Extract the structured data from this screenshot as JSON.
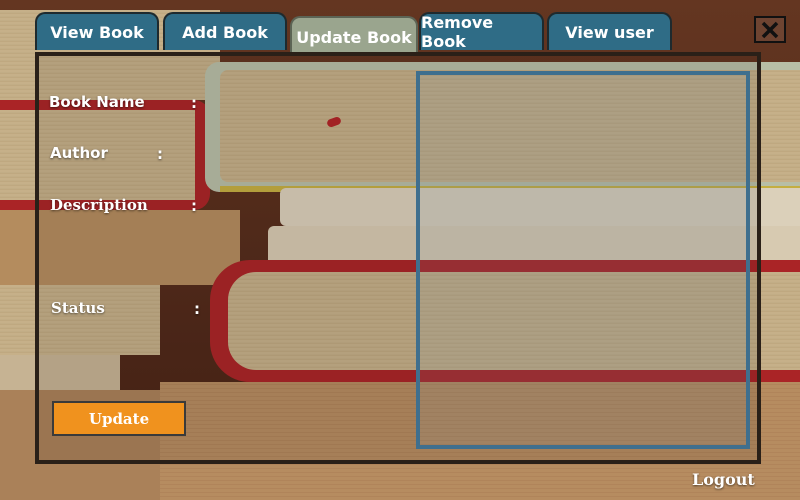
{
  "tabs": [
    {
      "label": "View Book",
      "active": false
    },
    {
      "label": "Add Book",
      "active": false
    },
    {
      "label": "Update Book",
      "active": true
    },
    {
      "label": "Remove Book",
      "active": false
    },
    {
      "label": "View user",
      "active": false
    }
  ],
  "form": {
    "book_name_label": "Book Name",
    "author_label": "Author",
    "description_label": "Description",
    "status_label": "Status",
    "separator": ":"
  },
  "update_label": "Update",
  "logout_label": "Logout",
  "close_icon": "close-icon",
  "colors": {
    "tab": "#2f6c86",
    "tab_active": "#9aa58e",
    "update_button": "#f0921e",
    "list_border": "#3f6f8e"
  }
}
